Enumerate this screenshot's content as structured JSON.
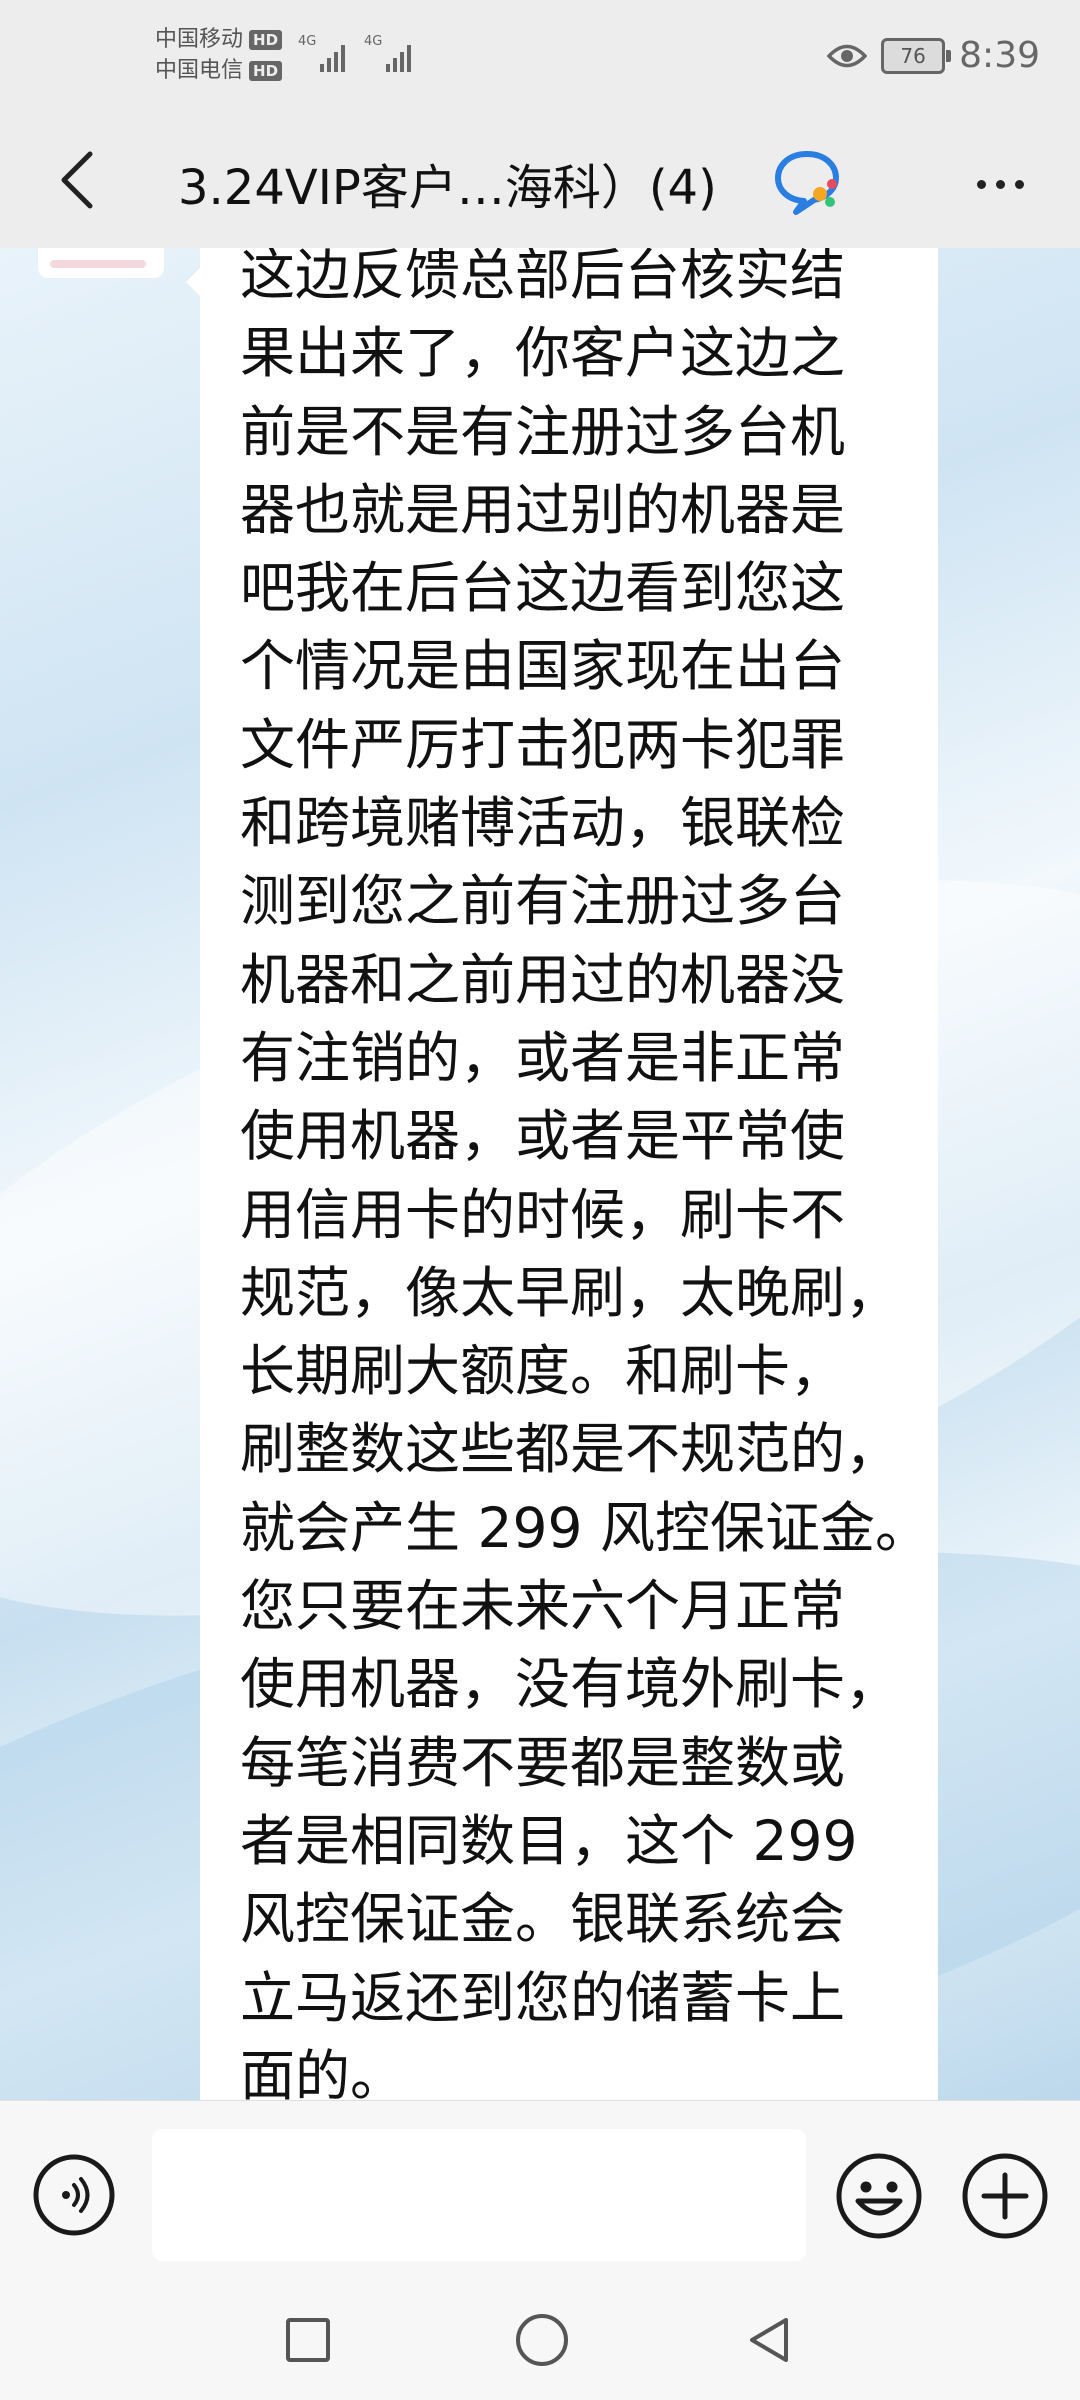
{
  "status_bar": {
    "carrier_1": "中国移动",
    "carrier_2": "中国电信",
    "hd_badge": "HD",
    "network": "4G",
    "battery": "76",
    "time": "8:39",
    "icons": [
      "eye-icon",
      "battery-icon"
    ]
  },
  "header": {
    "title": "3.24VIP客户…海科）(4)",
    "icons": [
      "back-arrow-icon",
      "group-chat-icon",
      "more-icon"
    ]
  },
  "message": {
    "lines": [
      "这边反馈总部后台核实结",
      "果出来了，你客户这边之",
      "前是不是有注册过多台机",
      "器也就是用过别的机器是",
      "吧我在后台这边看到您这",
      "个情况是由国家现在出台",
      "文件严厉打击犯两卡犯罪",
      "和跨境赌博活动，银联检",
      "测到您之前有注册过多台",
      "机器和之前用过的机器没",
      "有注销的，或者是非正常",
      "使用机器，或者是平常使",
      "用信用卡的时候，刷卡不",
      "规范，像太早刷，太晚刷，",
      "长期刷大额度。和刷卡，",
      "刷整数这些都是不规范的，",
      "就会产生 299 风控保证金。",
      "您只要在未来六个月正常",
      "使用机器，没有境外刷卡，",
      "每笔消费不要都是整数或",
      "者是相同数目，这个 299",
      "风控保证金。银联系统会",
      "立马返还到您的储蓄卡上",
      "面的。"
    ]
  },
  "input_bar": {
    "placeholder": "",
    "icons": [
      "voice-icon",
      "emoji-icon",
      "plus-icon"
    ]
  },
  "nav_bar": {
    "icons": [
      "recent-apps-icon",
      "home-icon",
      "back-icon"
    ]
  }
}
